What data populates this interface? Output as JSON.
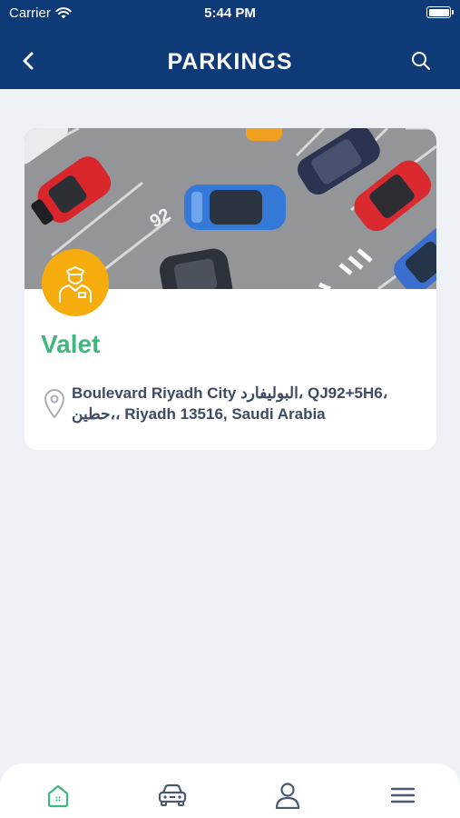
{
  "status_bar": {
    "carrier": "Carrier",
    "time": "5:44 PM"
  },
  "nav": {
    "title": "PARKINGS",
    "back_icon": "chevron-left-icon",
    "search_icon": "search-icon"
  },
  "parking_card": {
    "name": "Valet",
    "address": "Boulevard Riyadh City البوليفارد، QJ92+5H6، حطين،، Riyadh 13516, Saudi Arabia",
    "badge_icon": "valet-attendant-icon",
    "badge_color": "#f7ac0e",
    "name_color": "#3eb87e"
  },
  "tab_bar": {
    "items": [
      {
        "icon": "home-icon",
        "active": true
      },
      {
        "icon": "car-icon",
        "active": false
      },
      {
        "icon": "user-icon",
        "active": false
      },
      {
        "icon": "menu-icon",
        "active": false
      }
    ]
  },
  "colors": {
    "header": "#0e3a78",
    "background": "#eef1f6",
    "active_tab": "#3eb87e",
    "inactive_tab": "#4a5872"
  }
}
